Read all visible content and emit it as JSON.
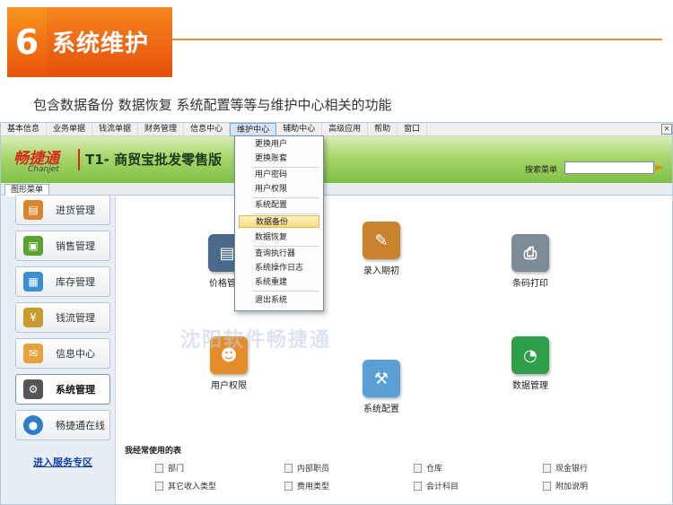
{
  "slide": {
    "number": "6",
    "title": "系统维护",
    "subtitle": "包含数据备份  数据恢复    系统配置等等与维护中心相关的功能"
  },
  "menubar": {
    "items": [
      "基本信息",
      "业务单据",
      "钱流单据",
      "财务管理",
      "信息中心",
      "维护中心",
      "辅助中心",
      "高级应用",
      "帮助",
      "窗口"
    ],
    "close": "×"
  },
  "brand": {
    "logo_cn": "畅捷通",
    "logo_en": "Chanjet",
    "product": "T1- 商贸宝批发零售版",
    "search_label": "搜索菜单"
  },
  "tab": {
    "label": "图形菜单"
  },
  "sidebar": {
    "items": [
      "进货管理",
      "销售管理",
      "库存管理",
      "钱流管理",
      "信息中心",
      "系统管理",
      "畅捷通在线"
    ],
    "selected": "系统管理",
    "link": "进入服务专区"
  },
  "dropdown": {
    "items": [
      "更换用户",
      "更换账套",
      "用户密码",
      "用户权限",
      "系统配置",
      "数据备份",
      "数据恢复",
      "查询执行器",
      "系统操作日志",
      "系统重建",
      "退出系统"
    ],
    "highlighted": "数据备份"
  },
  "features": {
    "price": "价格管理",
    "opening": "录入期初",
    "barcode": "条码打印",
    "user_rights": "用户权限",
    "sys_config": "系统配置",
    "data_mgmt": "数据管理"
  },
  "watermark": "沈阳软件畅捷通",
  "favorites": {
    "title": "我经常使用的表",
    "items": [
      "部门",
      "内部职员",
      "仓库",
      "现金银行",
      "其它收入类型",
      "费用类型",
      "会计科目",
      "附加说明"
    ]
  },
  "colors": {
    "accent": "#f08a3c",
    "brand_green": "#7fc045",
    "brand_red": "#d52b1e"
  }
}
